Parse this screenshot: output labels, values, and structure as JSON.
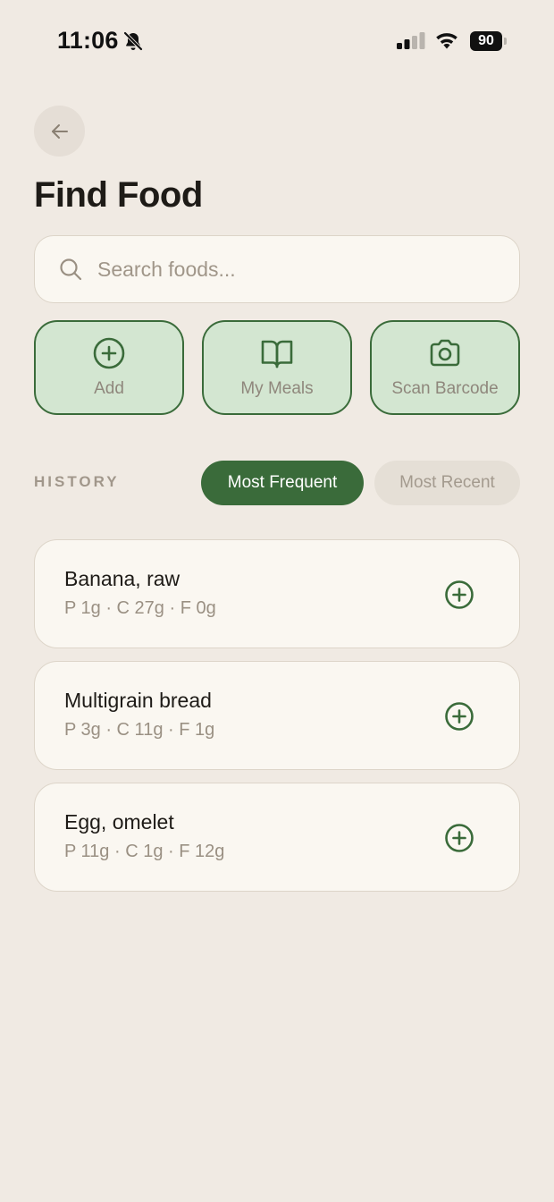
{
  "status_bar": {
    "time": "11:06",
    "battery": "90"
  },
  "header": {
    "title": "Find Food"
  },
  "search": {
    "placeholder": "Search foods..."
  },
  "actions": [
    {
      "label": "Add",
      "icon": "plus-circle-icon"
    },
    {
      "label": "My Meals",
      "icon": "book-open-icon"
    },
    {
      "label": "Scan Barcode",
      "icon": "camera-icon"
    }
  ],
  "history": {
    "label": "HISTORY",
    "tabs": [
      {
        "label": "Most Frequent",
        "selected": true
      },
      {
        "label": "Most Recent",
        "selected": false
      }
    ]
  },
  "foods": [
    {
      "name": "Banana, raw",
      "macros": "P 1g · C 27g · F 0g"
    },
    {
      "name": "Multigrain bread",
      "macros": "P 3g · C 11g · F 1g"
    },
    {
      "name": "Egg, omelet",
      "macros": "P 11g · C 1g · F 12g"
    }
  ],
  "colors": {
    "background": "#F0EAE3",
    "accent": "#3A6B3A",
    "accent_light": "#D3E6D1",
    "card": "#FAF7F1",
    "muted_text": "#9A9083"
  }
}
